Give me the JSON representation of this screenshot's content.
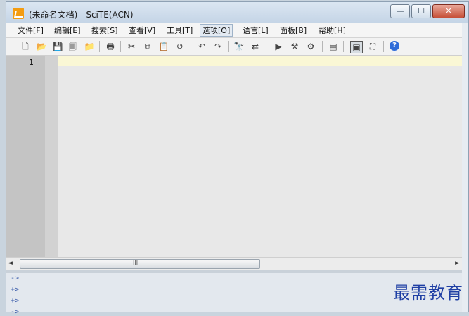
{
  "window": {
    "title": "(未命名文档) - SciTE(ACN)",
    "controls": {
      "minimize": "—",
      "maximize": "☐",
      "close": "✕"
    }
  },
  "menu": [
    "文件[F]",
    "编辑[E]",
    "搜索[S]",
    "查看[V]",
    "工具[T]",
    "选项[O]",
    "语言[L]",
    "面板[B]",
    "帮助[H]"
  ],
  "toolbar": {
    "icons": [
      "new-file-icon",
      "open-folder-icon",
      "save-icon",
      "save-all-icon",
      "open-folder-alt-icon",
      "print-icon",
      "cut-icon",
      "copy-icon",
      "paste-icon",
      "delete-icon",
      "undo-icon",
      "redo-icon",
      "find-icon",
      "replace-icon",
      "run-icon",
      "build-icon",
      "compile-icon",
      "panel-icon",
      "console-icon",
      "fullscreen-icon",
      "help-icon"
    ],
    "glyphs": {
      "new": "🗋",
      "open": "📂",
      "save": "💾",
      "saveall": "🗐",
      "open2": "📁",
      "print": "🖶",
      "cut": "✂",
      "copy": "⧉",
      "paste": "📋",
      "delete": "↺",
      "undo": "↶",
      "redo": "↷",
      "find": "🔭",
      "replace": "⇄",
      "run": "▶",
      "build": "⚒",
      "compile": "⚙",
      "panel": "▤",
      "console": "▣",
      "fullscreen": "⛶",
      "help": "?"
    }
  },
  "editor": {
    "line_number": "1"
  },
  "hscroll": {
    "left": "◄",
    "right": "►",
    "grip": "III"
  },
  "output": {
    "lines": [
      "->",
      "+>",
      "+>",
      "->"
    ]
  },
  "watermark": "最需教育"
}
